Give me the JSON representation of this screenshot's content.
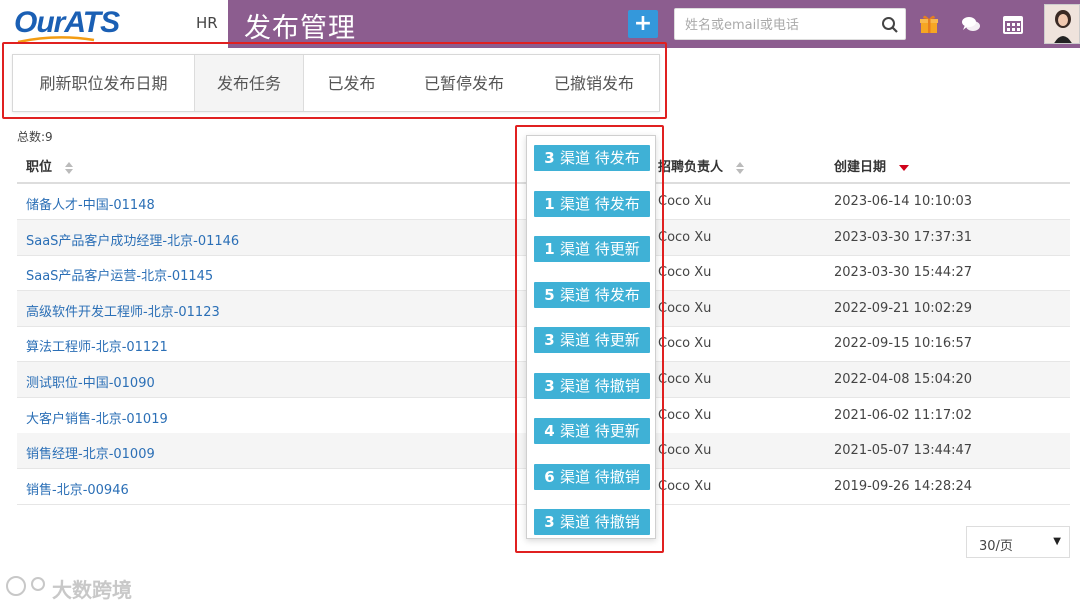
{
  "app": {
    "logo_part1": "Our",
    "logo_part2": "ATS",
    "section": "HR",
    "page_title": "发布管理"
  },
  "header": {
    "add_button": "+",
    "search_placeholder": "姓名或email或电话",
    "icons": [
      "search-icon",
      "gift-icon",
      "chat-icon",
      "calendar-icon",
      "avatar"
    ]
  },
  "tabs": [
    {
      "label": "刷新职位发布日期",
      "active": false
    },
    {
      "label": "发布任务",
      "active": true
    },
    {
      "label": "已发布",
      "active": false
    },
    {
      "label": "已暂停发布",
      "active": false
    },
    {
      "label": "已撤销发布",
      "active": false
    }
  ],
  "total": "总数:9",
  "table": {
    "columns": {
      "position": "职位",
      "recruiter": "招聘负责人",
      "created": "创建日期"
    },
    "rows": [
      {
        "position": "储备人才-中国-01148",
        "recruiter": "Coco Xu",
        "created": "2023-06-14 10:10:03"
      },
      {
        "position": "SaaS产品客户成功经理-北京-01146",
        "recruiter": "Coco Xu",
        "created": "2023-03-30 17:37:31"
      },
      {
        "position": "SaaS产品客户运营-北京-01145",
        "recruiter": "Coco Xu",
        "created": "2023-03-30 15:44:27"
      },
      {
        "position": "高级软件开发工程师-北京-01123",
        "recruiter": "Coco Xu",
        "created": "2022-09-21 10:02:29"
      },
      {
        "position": "算法工程师-北京-01121",
        "recruiter": "Coco Xu",
        "created": "2022-09-15 10:16:57"
      },
      {
        "position": "测试职位-中国-01090",
        "recruiter": "Coco Xu",
        "created": "2022-04-08 15:04:20"
      },
      {
        "position": "大客户销售-北京-01019",
        "recruiter": "Coco Xu",
        "created": "2021-06-02 11:17:02"
      },
      {
        "position": "销售经理-北京-01009",
        "recruiter": "Coco Xu",
        "created": "2021-05-07 13:44:47"
      },
      {
        "position": "销售-北京-00946",
        "recruiter": "Coco Xu",
        "created": "2019-09-26 14:28:24"
      }
    ]
  },
  "badges": [
    {
      "count": "3",
      "text": "渠道 待发布"
    },
    {
      "count": "1",
      "text": "渠道 待发布"
    },
    {
      "count": "1",
      "text": "渠道 待更新"
    },
    {
      "count": "5",
      "text": "渠道 待发布"
    },
    {
      "count": "3",
      "text": "渠道 待更新"
    },
    {
      "count": "3",
      "text": "渠道 待撤销"
    },
    {
      "count": "4",
      "text": "渠道 待更新"
    },
    {
      "count": "6",
      "text": "渠道 待撤销"
    },
    {
      "count": "3",
      "text": "渠道 待撤销"
    }
  ],
  "pager": {
    "per_page": "30/页"
  },
  "watermark": "大数跨境",
  "colors": {
    "header_purple": "#8c5d8f",
    "badge_blue": "#3fb1d6",
    "link_blue": "#2b6fb6",
    "highlight_red": "#e02020"
  }
}
